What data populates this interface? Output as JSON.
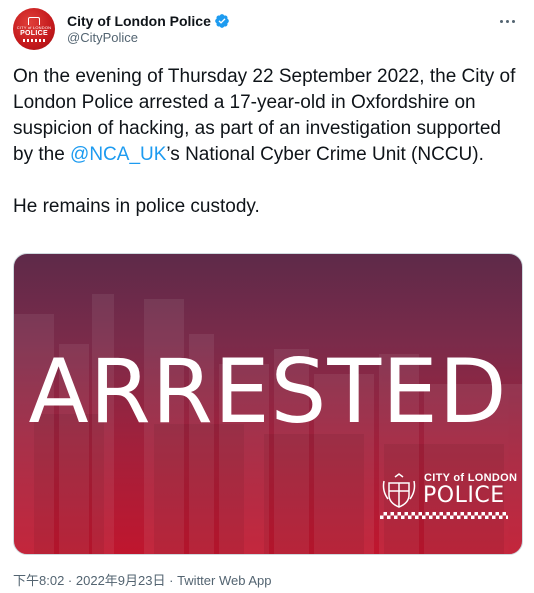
{
  "author": {
    "display_name": "City of London Police",
    "handle": "@CityPolice",
    "verified": true,
    "avatar_text_top": "CITY of LONDON",
    "avatar_text_bottom": "POLICE",
    "verified_color": "#1d9bf0"
  },
  "more_icon": "more-dots-icon",
  "tweet": {
    "text_before_mention": "On the evening of Thursday 22 September 2022, the City of London Police arrested a 17-year-old in Oxfordshire on suspicion of hacking, as part of an investigation supported by the ",
    "mention": "@NCA_UK",
    "text_after_mention": "’s National Cyber Crime Unit (NCCU).",
    "paragraph_2": "He remains in police custody."
  },
  "media": {
    "headline": "ARRESTED",
    "logo_text_top": "CITY of LONDON",
    "logo_text_bottom": "POLICE",
    "gradient_top": "#5e2a49",
    "gradient_bottom": "#c0162e"
  },
  "meta": {
    "time": "下午8:02",
    "separator": " · ",
    "date": "2022年9月23日",
    "source": "Twitter Web App"
  },
  "colors": {
    "text": "#0f1419",
    "secondary": "#536471",
    "link": "#1d9bf0"
  }
}
